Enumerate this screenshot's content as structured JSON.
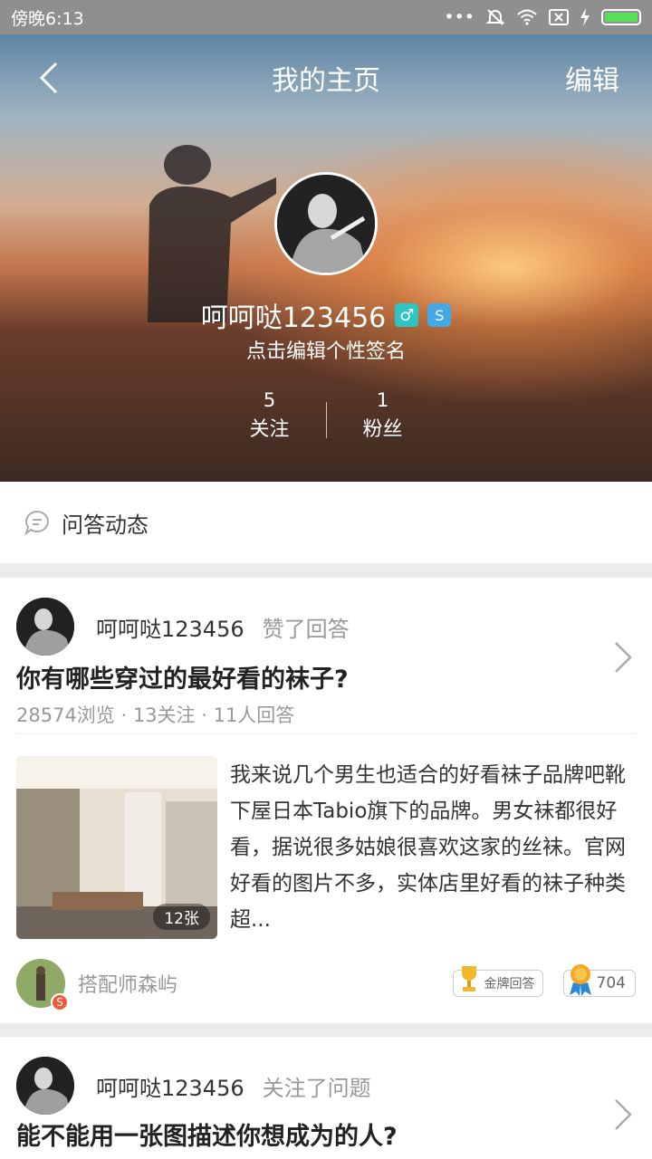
{
  "status_bar": {
    "time": "傍晚6:13",
    "icons": [
      "more-dots-icon",
      "mute-icon",
      "wifi-icon",
      "sim-icon",
      "charging-icon",
      "battery-icon"
    ]
  },
  "header": {
    "back_icon": "chevron-left-icon",
    "title": "我的主页",
    "edit_label": "编辑",
    "username": "呵呵哒123456",
    "gender_icon": "male-icon",
    "gender_symbol": "♂",
    "vip_icon": "s-badge-icon",
    "vip_symbol": "S",
    "signature": "点击编辑个性签名",
    "stats": [
      {
        "count": "5",
        "label": "关注"
      },
      {
        "count": "1",
        "label": "粉丝"
      }
    ]
  },
  "section": {
    "icon": "qa-bubble-icon",
    "title": "问答动态"
  },
  "feed": [
    {
      "user": "呵呵哒123456",
      "action": "赞了回答",
      "question": "你有哪些穿过的最好看的袜子?",
      "meta": "28574浏览 · 13关注 · 11人回答",
      "image_count": "12张",
      "answer_excerpt": "我来说几个男生也适合的好看袜子品牌吧靴下屋日本Tabio旗下的品牌。男女袜都很好看，据说很多姑娘很喜欢这家的丝袜。官网好看的图片不多，实体店里好看的袜子种类超...",
      "answerer": "搭配师森屿",
      "answerer_badge": "S",
      "gold_label": "金牌回答",
      "likes": "704"
    },
    {
      "user": "呵呵哒123456",
      "action": "关注了问题",
      "question": "能不能用一张图描述你想成为的人?"
    }
  ],
  "colors": {
    "accent_green": "#57e05a",
    "male_badge": "#2fc4c4",
    "s_badge": "#42a8e6",
    "muted_text": "#999999"
  }
}
